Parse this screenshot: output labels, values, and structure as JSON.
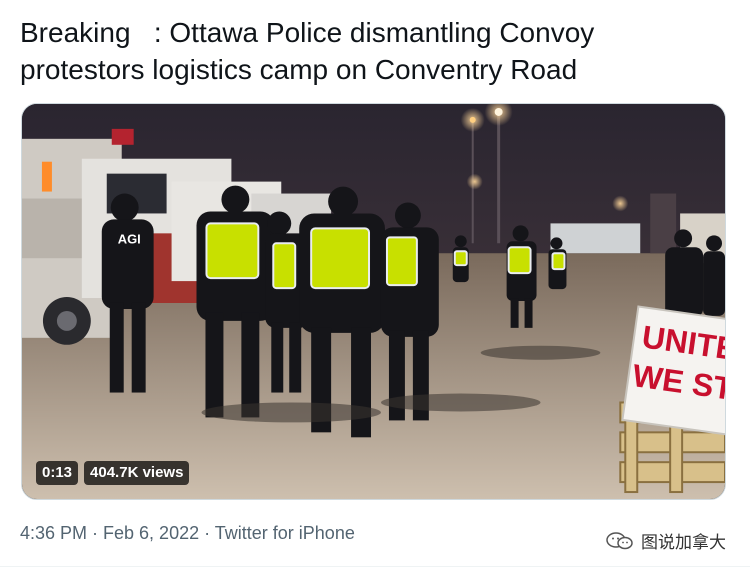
{
  "tweet": {
    "text": "Breaking   : Ottawa Police dismantling Convoy protestors logistics camp on Conventry Road",
    "timestamp": "4:36 PM · Feb 6, 2022 · ",
    "source": "Twitter for iPhone"
  },
  "video": {
    "duration": "0:13",
    "views": "404.7K views",
    "sign_line1": "UNITE",
    "sign_line2": "WE STA",
    "vest_text": "AGI"
  },
  "watermark": {
    "label": "图说加拿大",
    "icon": "wechat-icon"
  },
  "colors": {
    "text": "#0f1419",
    "secondary": "#536471",
    "sign_red": "#c8102e",
    "vest": "#c8e000"
  }
}
